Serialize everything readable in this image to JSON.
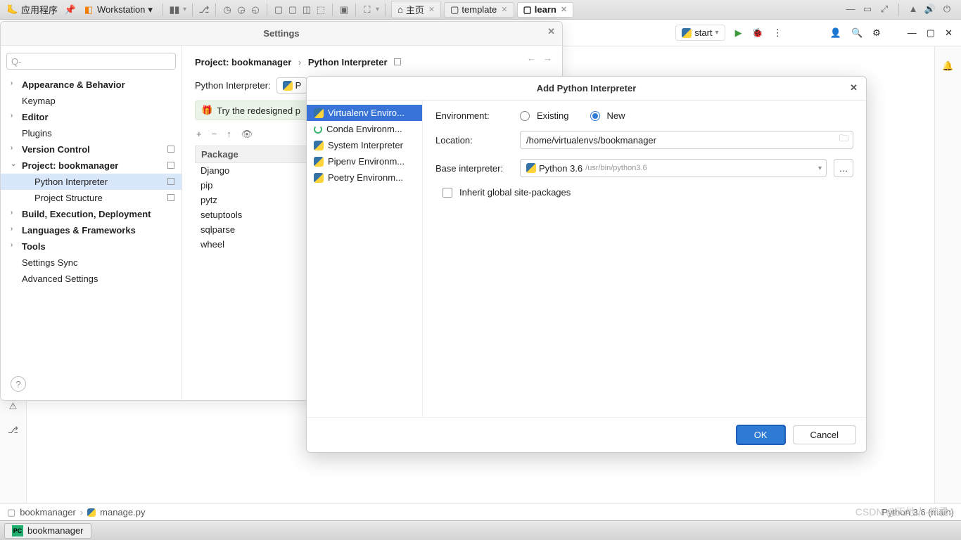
{
  "topbar": {
    "apps_label": "应用程序",
    "workstation": "Workstation",
    "tabs": [
      {
        "label": "主页"
      },
      {
        "label": "template"
      },
      {
        "label": "learn"
      }
    ]
  },
  "toolbar": {
    "start_label": "start"
  },
  "settings": {
    "title": "Settings",
    "search_placeholder": "",
    "nav": {
      "appearance": "Appearance & Behavior",
      "keymap": "Keymap",
      "editor": "Editor",
      "plugins": "Plugins",
      "version_control": "Version Control",
      "project": "Project: bookmanager",
      "python_interp": "Python Interpreter",
      "project_structure": "Project Structure",
      "build": "Build, Execution, Deployment",
      "languages": "Languages & Frameworks",
      "tools": "Tools",
      "settings_sync": "Settings Sync",
      "advanced": "Advanced Settings"
    },
    "content": {
      "crumb_project": "Project: bookmanager",
      "crumb_page": "Python Interpreter",
      "interp_label": "Python Interpreter:",
      "interp_value": "P",
      "banner": "Try the redesigned p",
      "package_header": "Package",
      "packages": [
        "Django",
        "pip",
        "pytz",
        "setuptools",
        "sqlparse",
        "wheel"
      ]
    }
  },
  "dialog": {
    "title": "Add Python Interpreter",
    "side": [
      "Virtualenv Enviro...",
      "Conda Environm...",
      "System Interpreter",
      "Pipenv Environm...",
      "Poetry Environm..."
    ],
    "env_label": "Environment:",
    "existing": "Existing",
    "new": "New",
    "location_label": "Location:",
    "location_value": "/home/virtualenvs/bookmanager",
    "base_label": "Base interpreter:",
    "base_value": "Python 3.6",
    "base_path": "/usr/bin/python3.6",
    "inherit": "Inherit global site-packages",
    "ok": "OK",
    "cancel": "Cancel"
  },
  "footer": {
    "project": "bookmanager",
    "file": "manage.py",
    "status": "Python 3.6 (main)"
  },
  "taskbar": {
    "item": "bookmanager"
  },
  "watermark": "CSDN @天地人-神君4"
}
